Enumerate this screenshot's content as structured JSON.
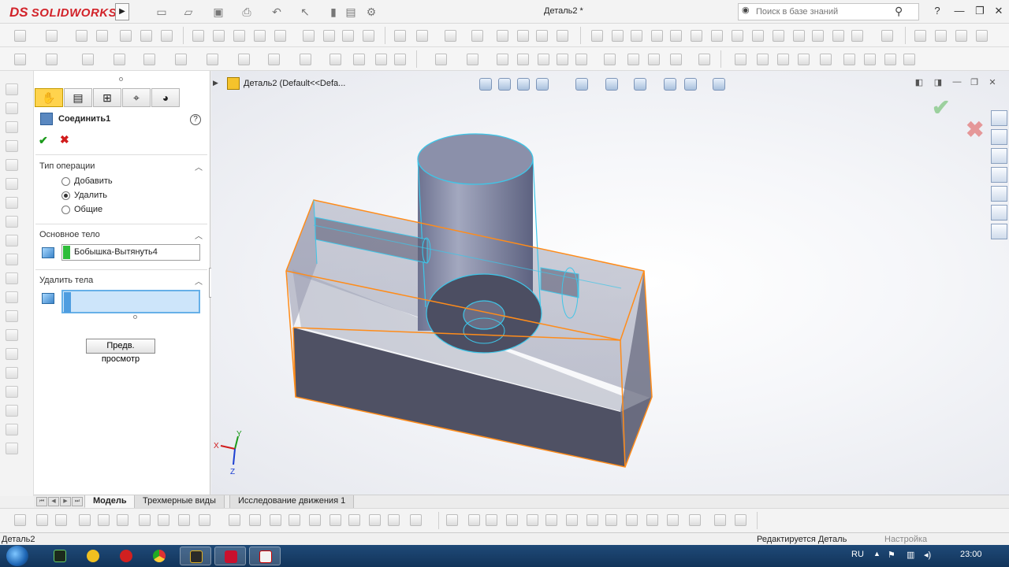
{
  "app": {
    "logo_prefix": "DS",
    "logo_name": "SOLIDWORKS",
    "document_title": "Деталь2 *"
  },
  "search": {
    "placeholder": "Поиск в базе знаний"
  },
  "feature_tree": {
    "breadcrumb": "Деталь2  (Default<<Defa..."
  },
  "property_manager": {
    "title": "Соединить1",
    "help": "?",
    "ok": "✔",
    "cancel": "✖",
    "tabs": [
      "feature-manager",
      "property-manager",
      "configuration-manager",
      "dimxpert-manager",
      "display-manager"
    ],
    "operation_type": {
      "title": "Тип операции",
      "options": [
        {
          "label": "Добавить",
          "checked": false
        },
        {
          "label": "Удалить",
          "checked": true
        },
        {
          "label": "Общие",
          "checked": false
        }
      ]
    },
    "main_body": {
      "title": "Основное тело",
      "value": "Бобышка-Вытянуть4"
    },
    "subtract_bodies": {
      "title": "Удалить тела",
      "value": ""
    },
    "preview_button": "Предв. просмотр"
  },
  "bottom_tabs": [
    {
      "label": "Модель",
      "active": true
    },
    {
      "label": "Трехмерные виды",
      "active": false
    },
    {
      "label": "Исследование движения 1",
      "active": false
    }
  ],
  "status_bar": {
    "document": "Деталь2",
    "mode": "Редактируется Деталь",
    "settings": "Настройка"
  },
  "taskbar": {
    "language": "RU",
    "time": "23:00"
  },
  "triad": {
    "x": "X",
    "y": "Y",
    "z": "Z"
  },
  "colors": {
    "accent_orange": "#ff8c1a",
    "edge_cyan": "#3ec6e8",
    "body_fill": "#8a8fa8",
    "selection_blue": "#cde5fa",
    "main_body_color": "#2ebd3a"
  }
}
